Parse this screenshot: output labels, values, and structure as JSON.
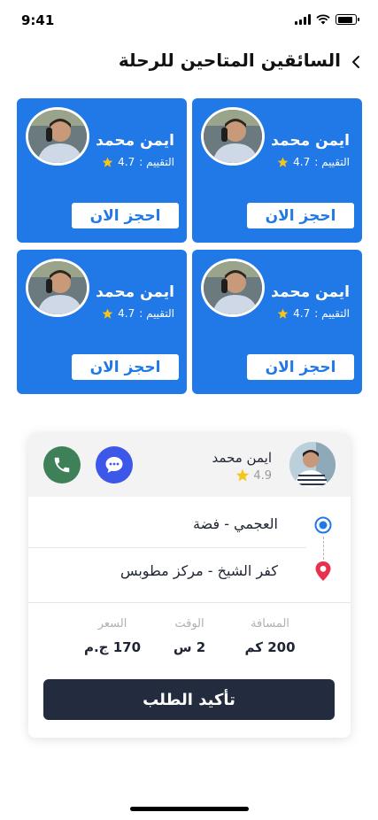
{
  "status_bar": {
    "time": "9:41",
    "battery_level": 0.85
  },
  "header": {
    "title": "السائقين المتاحين للرحلة",
    "back_icon": "chevron-left-icon"
  },
  "drivers": [
    {
      "name": "ايمن محمد",
      "rating_label": "التقييم :",
      "rating": "4.7",
      "book_label": "احجز الان"
    },
    {
      "name": "ايمن محمد",
      "rating_label": "التقييم :",
      "rating": "4.7",
      "book_label": "احجز الان"
    },
    {
      "name": "ايمن محمد",
      "rating_label": "التقييم :",
      "rating": "4.7",
      "book_label": "احجز الان"
    },
    {
      "name": "ايمن محمد",
      "rating_label": "التقييم :",
      "rating": "4.7",
      "book_label": "احجز الان"
    }
  ],
  "trip": {
    "driver_name": "ايمن محمد",
    "driver_rating": "4.9",
    "pickup": "العجمي - فضة",
    "dropoff": "كفر الشيخ - مركز مطوبس",
    "stats": {
      "distance_label": "المسافة",
      "distance_value": "200 كم",
      "time_label": "الوقت",
      "time_value": "2 س",
      "price_label": "السعر",
      "price_value": "170 ج.م"
    },
    "confirm_label": "تأكيد الطلب"
  },
  "colors": {
    "card_blue": "#2079e6",
    "call_green": "#3e8159",
    "chat_blue": "#3d57e8",
    "confirm_dark": "#232b3e",
    "star_yellow": "#f5c518",
    "pin_red": "#e8324d"
  }
}
